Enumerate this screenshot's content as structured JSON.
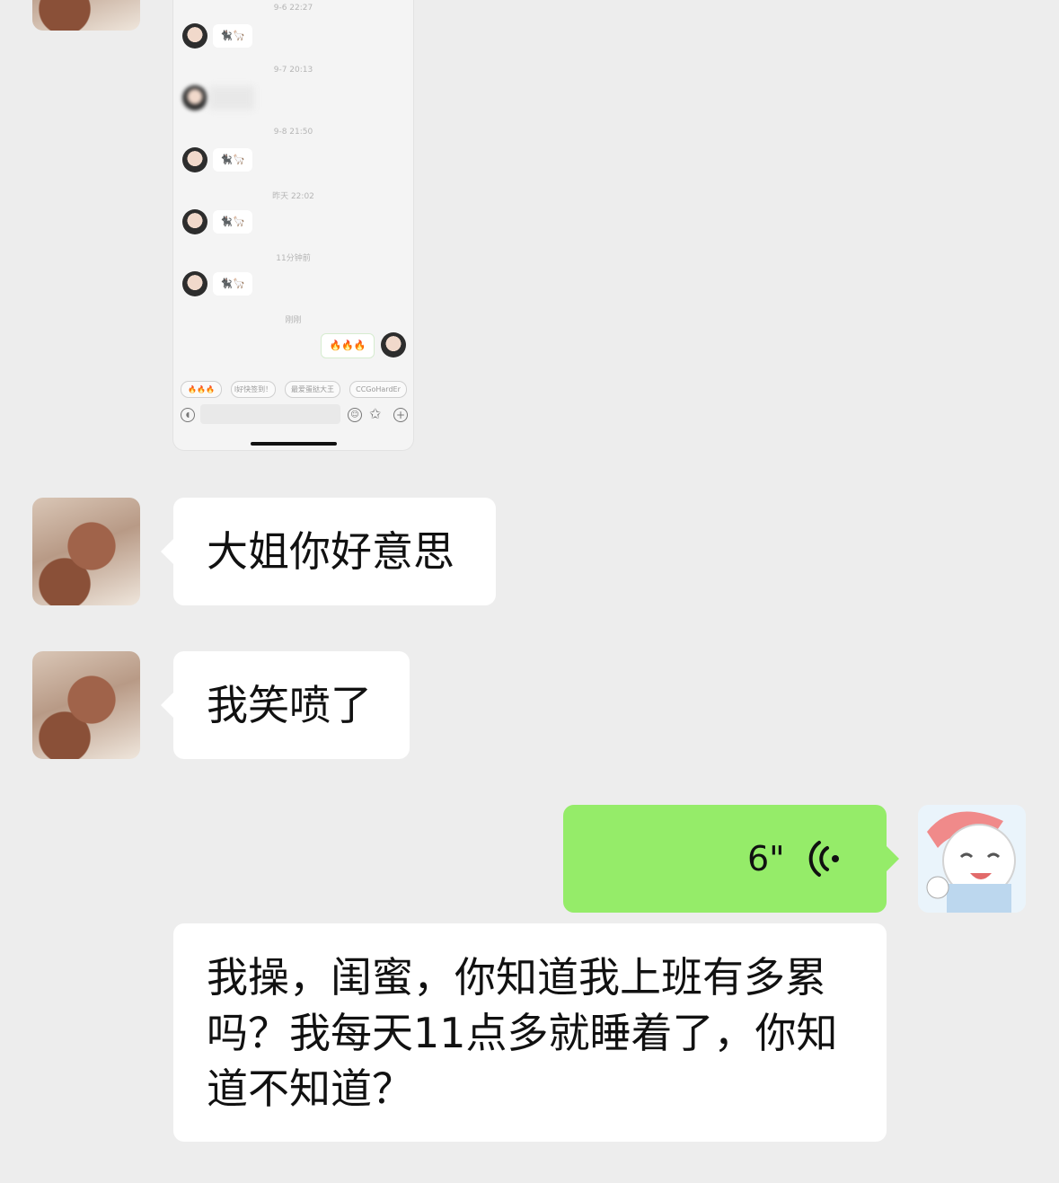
{
  "screenshot": {
    "timestamps": [
      "9-6 22:27",
      "9-7 20:13",
      "9-8 21:50",
      "昨天 22:02",
      "11分钟前",
      "刚刚"
    ],
    "sticker_text": "🐈‍⬛🦙",
    "sent_emoji": "🔥🔥🔥",
    "quick_replies": [
      "🔥🔥🔥",
      "l好快签到！",
      "最爱蛋挞大王",
      "CCGoHardEr"
    ]
  },
  "messages": [
    {
      "side": "left",
      "text": "大姐你好意思"
    },
    {
      "side": "left",
      "text": "我笑喷了"
    },
    {
      "side": "right",
      "type": "voice",
      "duration": "6\""
    },
    {
      "side": "left",
      "text": "我操，闺蜜，你知道我上班有多累吗？我每天11点多就睡着了，你知道不知道？"
    }
  ],
  "colors": {
    "background": "#ededed",
    "bubble_received": "#ffffff",
    "bubble_sent": "#95ec69"
  },
  "icons": [
    "voice-wave-icon",
    "emoji-icon",
    "sticker-icon",
    "plus-icon",
    "voice-input-icon"
  ]
}
